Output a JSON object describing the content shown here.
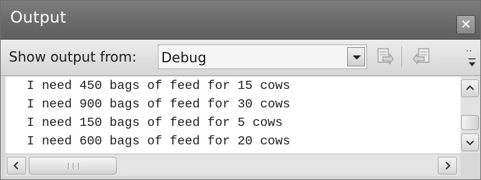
{
  "window": {
    "title": "Output",
    "close_label": "×"
  },
  "toolbar": {
    "show_output_label": "Show output from:",
    "source_value": "Debug",
    "overflow_label": "..",
    "buttons": [
      "go-to-next-message-icon",
      "go-to-previous-message-icon"
    ]
  },
  "output": {
    "lines": [
      "I need 450 bags of feed for 15 cows",
      "I need 900 bags of feed for 30 cows",
      "I need 150 bags of feed for 5 cows",
      "I need 600 bags of feed for 20 cows"
    ]
  },
  "colors": {
    "title_bar": "#6a6a6a",
    "panel": "#d8d8d8",
    "output_background": "#ffffff",
    "text": "#1f1f1f"
  }
}
